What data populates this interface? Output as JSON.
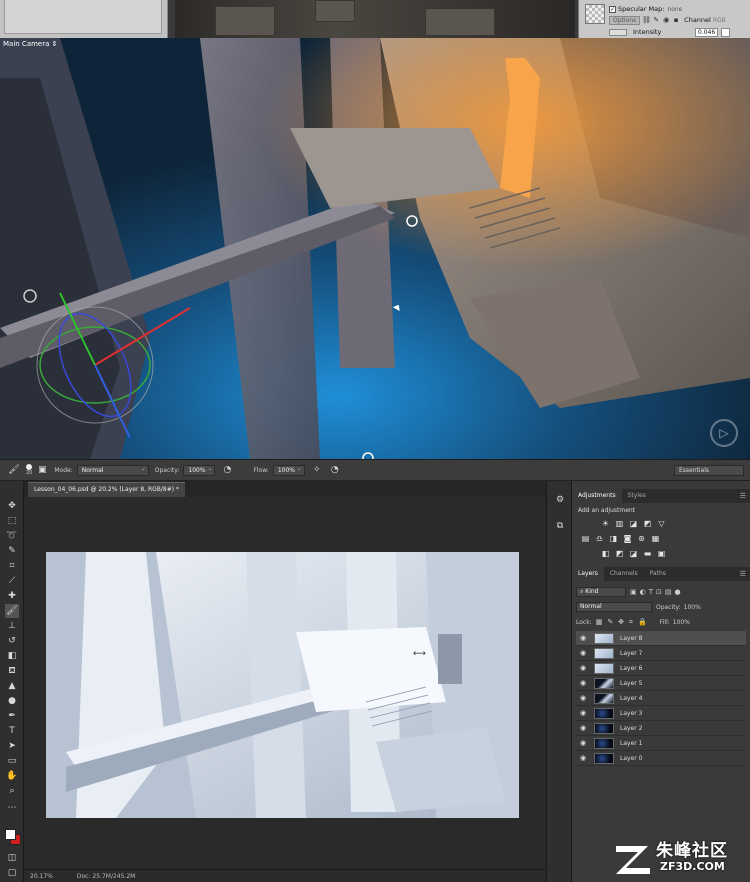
{
  "unity": {
    "inspector": {
      "specular_label": "Specular Map:",
      "specular_value": "none",
      "options_label": "Options",
      "channel_label": "Channel",
      "channel_value": "RGB",
      "intensity_label": "Intensity",
      "intensity_value": "0.046"
    },
    "scene": {
      "camera_label": "Main Camera ⇕"
    }
  },
  "photoshop": {
    "options": {
      "brush_size": "20",
      "mode_label": "Mode:",
      "mode_value": "Normal",
      "opacity_label": "Opacity:",
      "opacity_value": "100%",
      "flow_label": "Flow:",
      "flow_value": "100%",
      "workspace": "Essentials"
    },
    "document": {
      "tab_title": "Lesson_04_06.psd @ 20.2% (Layer 8, RGB/8#) *",
      "zoom": "20.17%",
      "doc_size": "Doc: 25.7M/245.2M"
    },
    "adjustments": {
      "tab_active": "Adjustments",
      "tab_other": "Styles",
      "hint": "Add an adjustment"
    },
    "layers": {
      "tabs": [
        "Layers",
        "Channels",
        "Paths"
      ],
      "kind_label": "Kind",
      "blend_mode": "Normal",
      "opacity_label": "Opacity:",
      "opacity_value": "100%",
      "lock_label": "Lock:",
      "fill_label": "Fill:",
      "fill_value": "100%",
      "items": [
        {
          "name": "Layer 8",
          "thumb": "light"
        },
        {
          "name": "Layer 7",
          "thumb": "light"
        },
        {
          "name": "Layer 6",
          "thumb": "light"
        },
        {
          "name": "Layer 5",
          "thumb": "mixed"
        },
        {
          "name": "Layer 4",
          "thumb": "mixed"
        },
        {
          "name": "Layer 3",
          "thumb": "dark"
        },
        {
          "name": "Layer 2",
          "thumb": "dark"
        },
        {
          "name": "Layer 1",
          "thumb": "dark"
        },
        {
          "name": "Layer 0",
          "thumb": "dark"
        }
      ]
    }
  },
  "watermark": {
    "brand": "朱峰社区",
    "url": "ZF3D.COM"
  },
  "colors": {
    "foreground": "#ffffff",
    "background": "#d21f1f",
    "scene_glow_orange": "#f59a3a",
    "scene_glow_blue": "#1f8fd8"
  }
}
